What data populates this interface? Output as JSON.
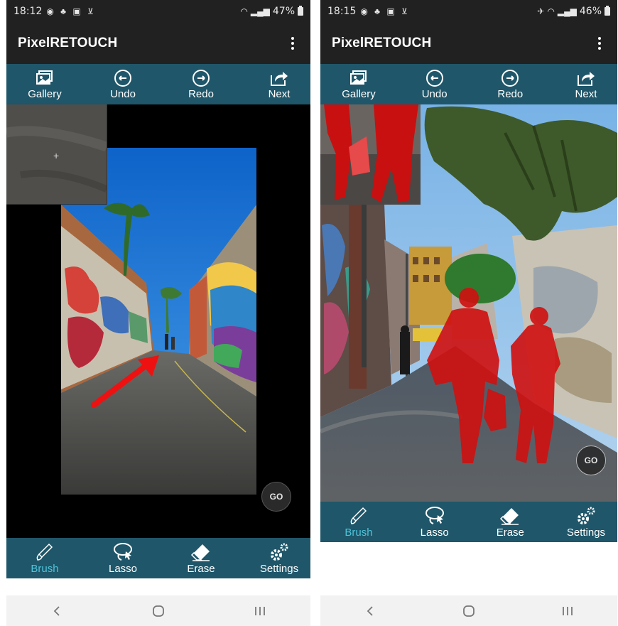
{
  "colors": {
    "app_bar_bg": "#212121",
    "toolbar_bg": "#1f5669",
    "active_tool": "#4fc3d9",
    "mask_red": "#d01010"
  },
  "left": {
    "status": {
      "time": "18:12",
      "battery": "47%"
    },
    "app": {
      "title": "PixelRETOUCH"
    },
    "toolbar": {
      "gallery": "Gallery",
      "undo": "Undo",
      "redo": "Redo",
      "next": "Next"
    },
    "go": "GO",
    "tools": {
      "brush": "Brush",
      "lasso": "Lasso",
      "erase": "Erase",
      "settings": "Settings"
    },
    "active_tool": "brush",
    "icons": [
      "gallery-icon",
      "undo-icon",
      "redo-icon",
      "next-icon",
      "brush-icon",
      "lasso-icon",
      "erase-icon",
      "settings-icon",
      "back-icon",
      "home-icon",
      "recents-icon"
    ]
  },
  "right": {
    "status": {
      "time": "18:15",
      "battery": "46%"
    },
    "app": {
      "title": "PixelRETOUCH"
    },
    "toolbar": {
      "gallery": "Gallery",
      "undo": "Undo",
      "redo": "Redo",
      "next": "Next"
    },
    "go": "GO",
    "tools": {
      "brush": "Brush",
      "lasso": "Lasso",
      "erase": "Erase",
      "settings": "Settings"
    },
    "active_tool": "brush"
  }
}
